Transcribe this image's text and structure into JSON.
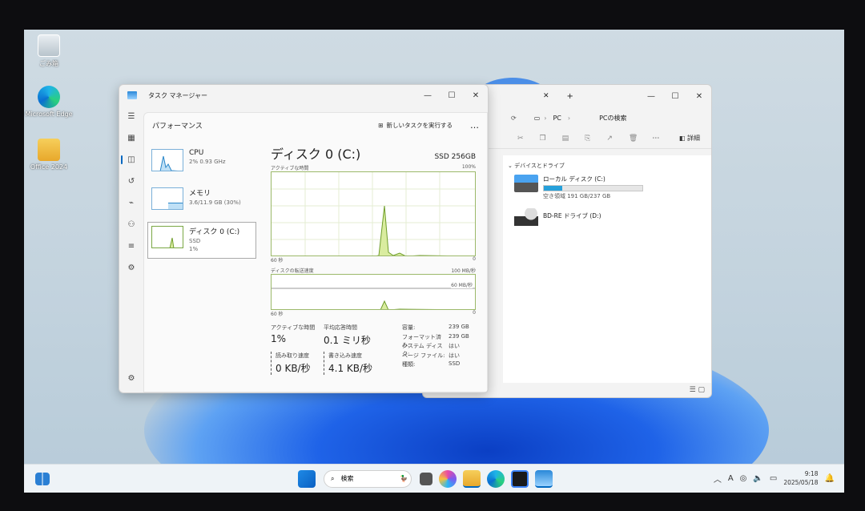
{
  "desktop": {
    "icons": [
      {
        "label": "ごみ箱",
        "icon": "recycle-bin-icon"
      },
      {
        "label": "Microsoft Edge",
        "icon": "edge-icon"
      },
      {
        "label": "Office 2024",
        "icon": "folder-icon"
      }
    ]
  },
  "taskmgr": {
    "title": "タスク マネージャー",
    "header": "パフォーマンス",
    "run_task": "新しいタスクを実行する",
    "more": "…",
    "items": [
      {
        "name": "CPU",
        "sub": "2% 0.93 GHz",
        "sub2": ""
      },
      {
        "name": "メモリ",
        "sub": "3.6/11.9 GB (30%)",
        "sub2": ""
      },
      {
        "name": "ディスク 0 (C:)",
        "sub": "SSD",
        "sub2": "1%"
      }
    ],
    "detail": {
      "title": "ディスク 0 (C:)",
      "model": "SSD 256GB",
      "graph1_label": "アクティブな時間",
      "graph1_max": "100%",
      "graph1_left": "60 秒",
      "graph1_right": "0",
      "graph2_label": "ディスクの転送速度",
      "graph2_max": "100 MB/秒",
      "graph2_mid": "60 MB/秒",
      "graph2_left": "60 秒",
      "graph2_right": "0",
      "stats": {
        "active_label": "アクティブな時間",
        "active_value": "1%",
        "resp_label": "平均応答時間",
        "resp_value": "0.1 ミリ秒",
        "read_label": "読み取り速度",
        "read_value": "0 KB/秒",
        "write_label": "書き込み速度",
        "write_value": "4.1 KB/秒"
      },
      "props": [
        {
          "k": "容量:",
          "v": "239 GB"
        },
        {
          "k": "フォーマット済み:",
          "v": "239 GB"
        },
        {
          "k": "システム ディスク:",
          "v": "はい"
        },
        {
          "k": "ページ ファイル:",
          "v": "はい"
        },
        {
          "k": "種類:",
          "v": "SSD"
        }
      ]
    }
  },
  "explorer": {
    "tab_close": "✕",
    "tab_add": "+",
    "crumb": "PC",
    "search_placeholder": "PCの検索",
    "details": "詳細",
    "section": "デバイスとドライブ",
    "drives": [
      {
        "name": "ローカル ディスク (C:)",
        "free": "空き領域 191 GB/237 GB",
        "used_fraction": 0.19
      },
      {
        "name": "BD-RE ドライブ (D:)",
        "free": ""
      }
    ]
  },
  "taskbar": {
    "search_label": "検索",
    "time": "9:18",
    "date": "2025/05/18",
    "ime": "A"
  }
}
